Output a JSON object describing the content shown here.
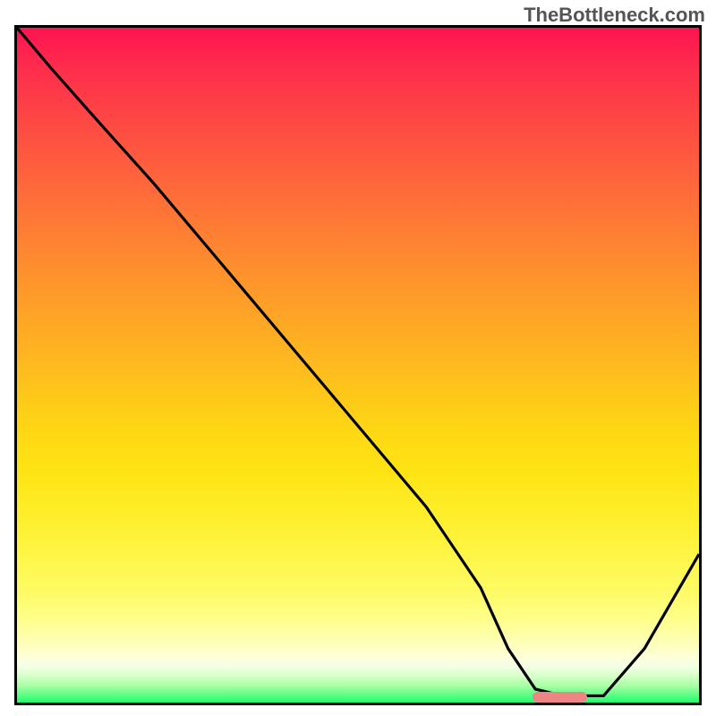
{
  "watermark": "TheBottleneck.com",
  "chart_data": {
    "type": "line",
    "title": "",
    "xlabel": "",
    "ylabel": "",
    "xlim": [
      0,
      100
    ],
    "ylim": [
      0,
      100
    ],
    "series": [
      {
        "name": "curve",
        "x": [
          0,
          5,
          12,
          20,
          30,
          40,
          50,
          60,
          68,
          72,
          76,
          80,
          86,
          92,
          100
        ],
        "values": [
          100,
          94,
          86,
          77,
          65,
          53,
          41,
          29,
          17,
          8,
          2,
          1,
          1,
          8,
          22
        ]
      }
    ],
    "indicator": {
      "x_start": 75,
      "x_end": 83,
      "y": 1.6,
      "color": "#ee8585"
    },
    "gradient_stops": [
      {
        "pos": 0,
        "color": "#fd1450"
      },
      {
        "pos": 24,
        "color": "#fe6a3a"
      },
      {
        "pos": 48,
        "color": "#feb421"
      },
      {
        "pos": 72,
        "color": "#feee2a"
      },
      {
        "pos": 88,
        "color": "#feff8f"
      },
      {
        "pos": 96,
        "color": "#d8ffc9"
      },
      {
        "pos": 100,
        "color": "#20fd6f"
      }
    ]
  }
}
